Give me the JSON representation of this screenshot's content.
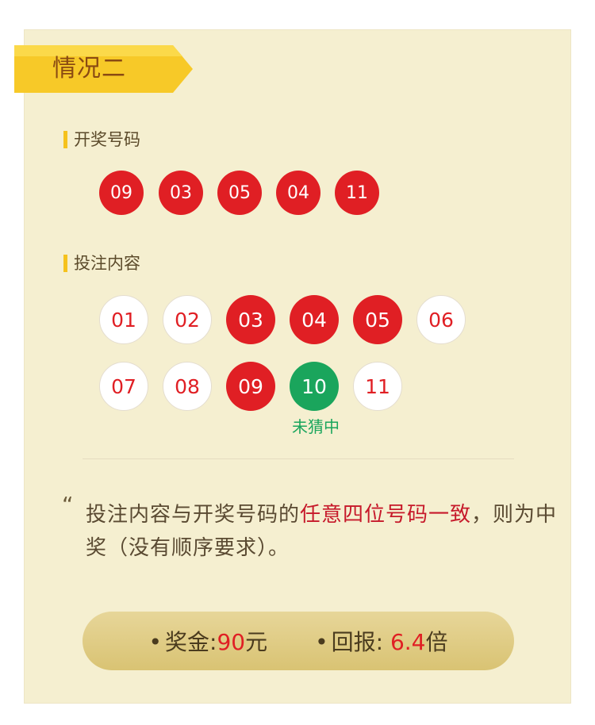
{
  "ribbon": {
    "title": "情况二"
  },
  "draw": {
    "title": "开奖号码",
    "numbers": [
      "09",
      "03",
      "05",
      "04",
      "11"
    ]
  },
  "bet": {
    "title": "投注内容",
    "row1": [
      "01",
      "02",
      "03",
      "04",
      "05",
      "06"
    ],
    "row2": [
      "07",
      "08",
      "09",
      "10",
      "11"
    ],
    "miss_label": "未猜中"
  },
  "note": {
    "quote": "“",
    "prefix": "投注内容与开奖号码的",
    "highlight": "任意四位号码一致",
    "suffix": "，则为中奖（没有顺序要求）。"
  },
  "prize": {
    "bullet": "•",
    "bonus_label": "奖金:",
    "bonus_value": "90",
    "bonus_unit": "元",
    "return_label": "回报: ",
    "return_value": "6.4",
    "return_unit": "倍"
  },
  "colors": {
    "red": "#e01f24",
    "green": "#1aa55c",
    "gold": "#f5c21d",
    "card": "#f5efd0"
  }
}
